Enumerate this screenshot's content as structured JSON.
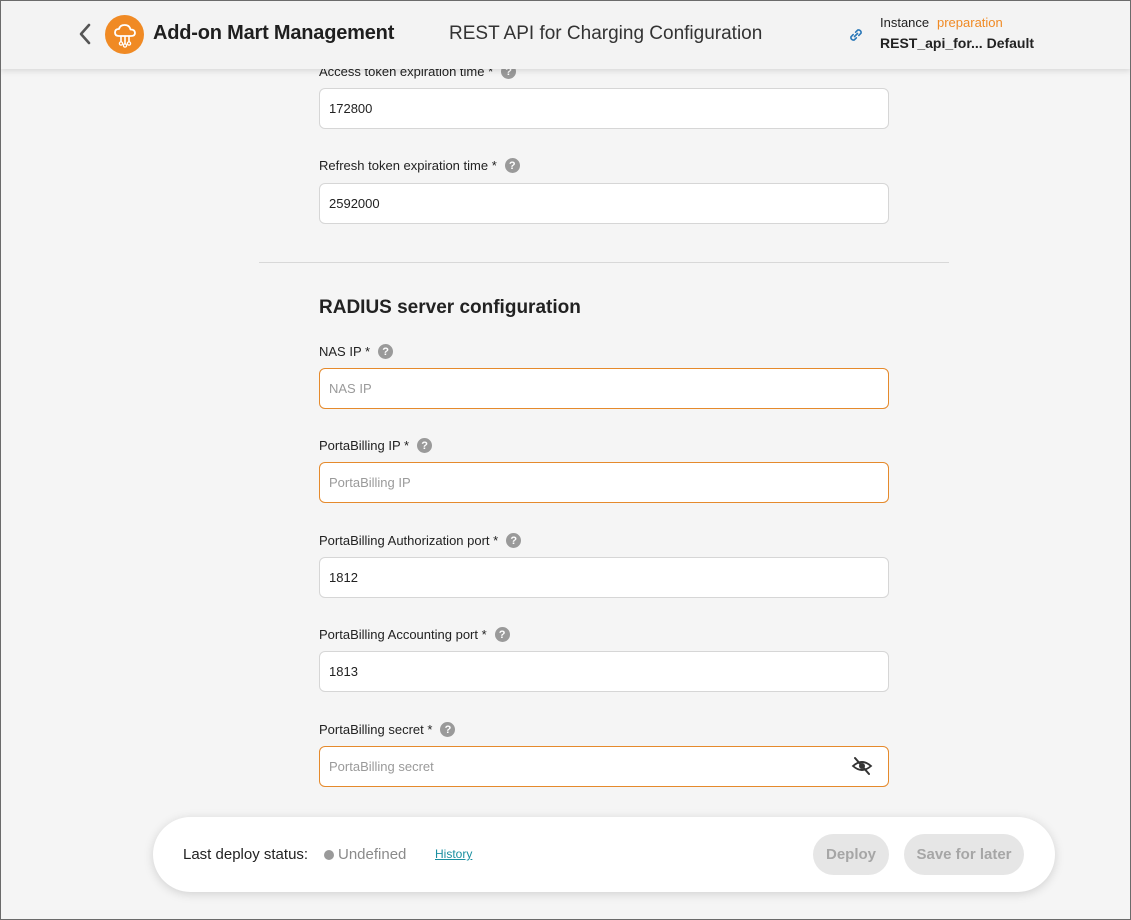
{
  "header": {
    "back_icon": "chevron-left-icon",
    "logo_icon": "cloud-network-icon",
    "app_title": "Add-on Mart Management",
    "page_title": "REST API for Charging Configuration",
    "link_icon": "link-icon",
    "instance_label": "Instance",
    "instance_status": "preparation",
    "instance_name": "REST_api_for... Default",
    "accent_color": "#f08a24"
  },
  "fields_top": {
    "access_token": {
      "label": "Access token expiration time *",
      "value": "172800"
    },
    "refresh_token": {
      "label": "Refresh token expiration time *",
      "value": "2592000"
    }
  },
  "radius": {
    "section_title": "RADIUS server configuration",
    "nas_ip": {
      "label": "NAS IP *",
      "value": "",
      "placeholder": "NAS IP"
    },
    "pb_ip": {
      "label": "PortaBilling IP *",
      "value": "",
      "placeholder": "PortaBilling IP"
    },
    "auth_port": {
      "label": "PortaBilling Authorization port *",
      "value": "1812"
    },
    "acct_port": {
      "label": "PortaBilling Accounting port *",
      "value": "1813"
    },
    "secret": {
      "label": "PortaBilling secret *",
      "value": "",
      "placeholder": "PortaBilling secret",
      "toggle_icon": "eye-off-icon"
    }
  },
  "help_glyph": "?",
  "footer": {
    "deploy_label": "Last deploy status:",
    "status": "Undefined",
    "history": "History",
    "deploy_button": "Deploy",
    "save_button": "Save for later"
  }
}
